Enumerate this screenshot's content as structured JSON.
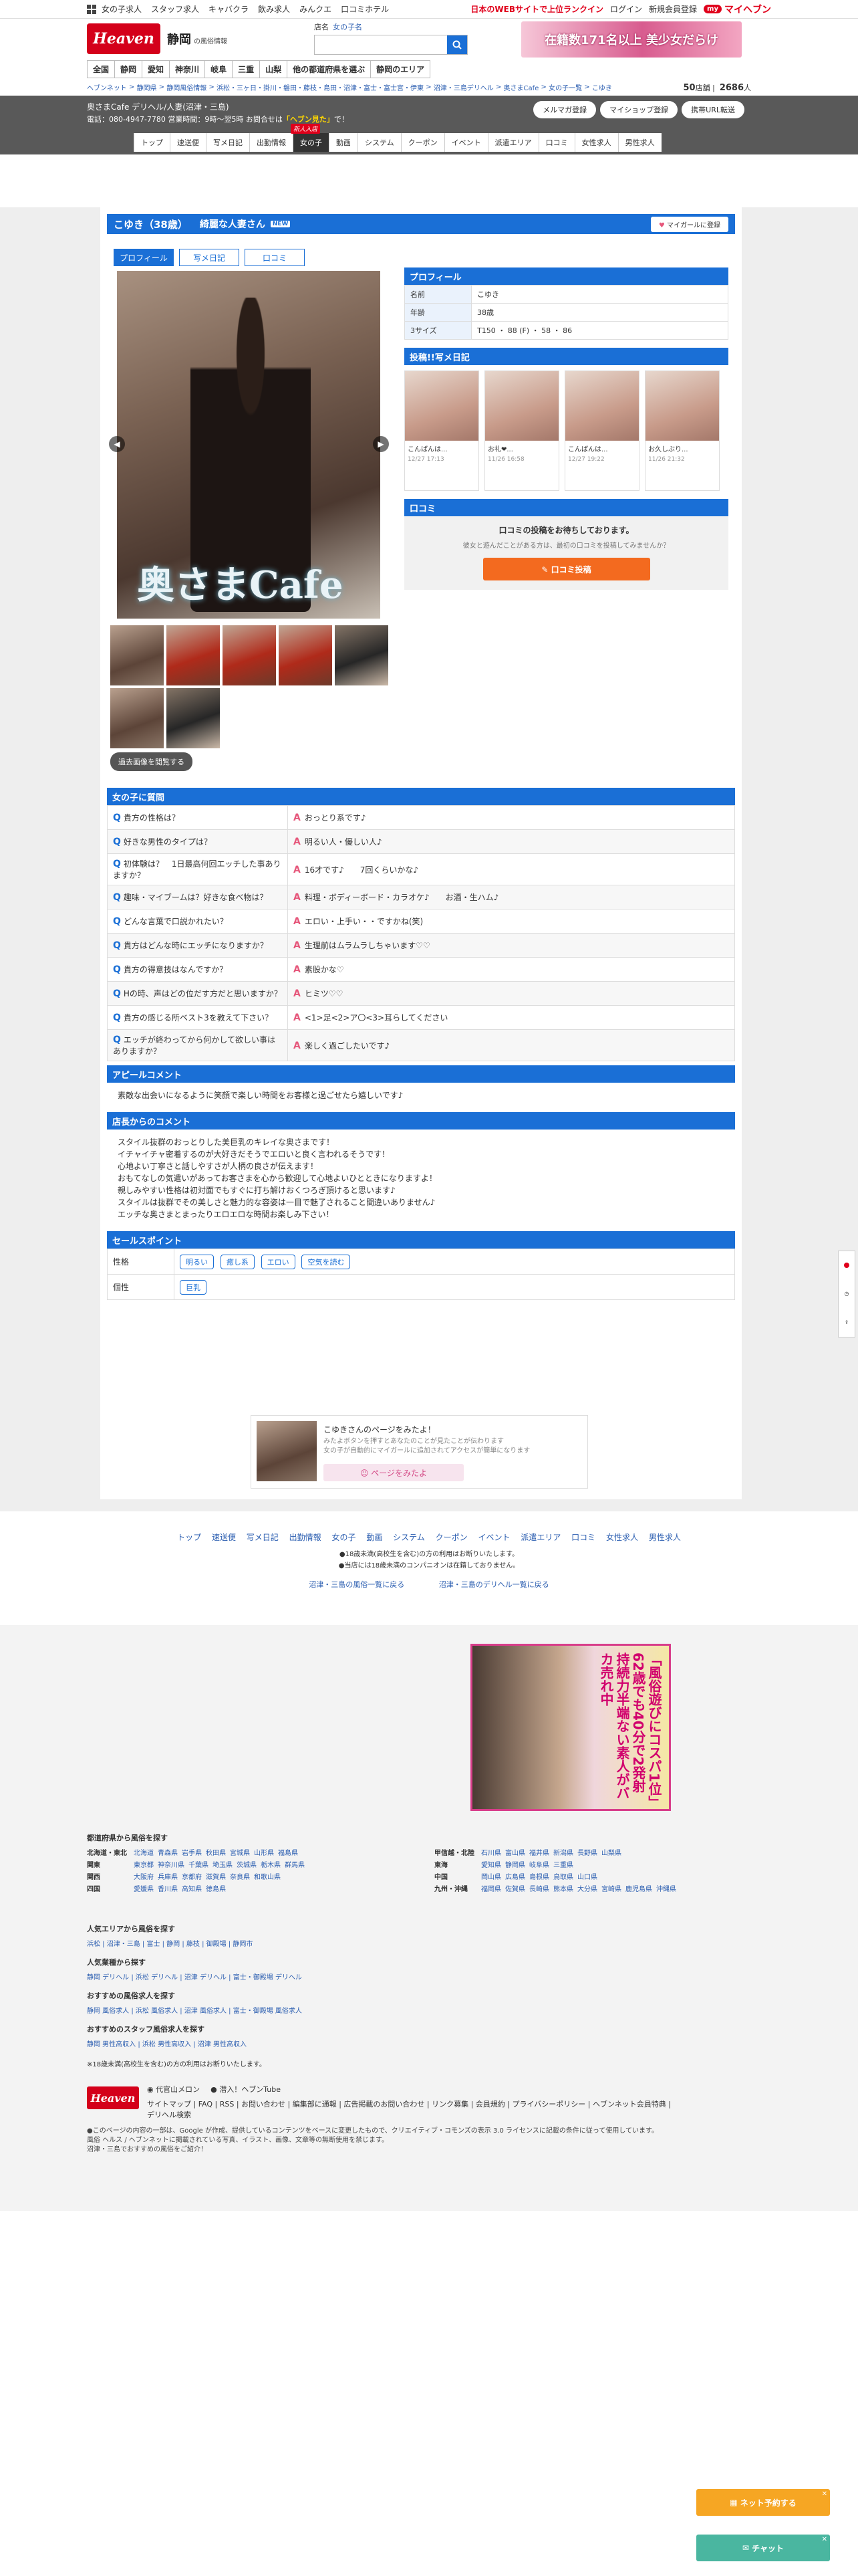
{
  "topbar": {
    "links": [
      "女の子求人",
      "スタッフ求人",
      "キャバクラ",
      "飲み求人",
      "みんクエ",
      "口コミホテル"
    ],
    "tagline": "日本のWEBサイトで上位ランクイン",
    "login": "ログイン",
    "register": "新規会員登録",
    "my_badge": "my",
    "my_label": "マイヘブン"
  },
  "header": {
    "logo": "Heaven",
    "region": "静岡",
    "region_sub": "の風俗情報",
    "search_label": "店名",
    "search_mode": "女の子名",
    "banner": "在籍数171名以上 美少女だらけ"
  },
  "prefnav": [
    "全国",
    "静岡",
    "愛知",
    "神奈川",
    "岐阜",
    "三重",
    "山梨",
    "他の都道府県を選ぶ",
    "静岡のエリア"
  ],
  "breadcrumb": {
    "items": [
      "ヘブンネット",
      "静岡県",
      "静岡風俗情報",
      "浜松・三ヶ日・掛川・磐田・藤枝・島田・沼津・富士・富士宮・伊東",
      "沼津・三島デリヘル",
      "奥さまCafe",
      "女の子一覧",
      "こゆき"
    ],
    "count_num": "50",
    "count_unit": "店舗",
    "count2_num": "2686",
    "count2_unit": "人"
  },
  "shop": {
    "name": "奥さまCafe デリヘル/人妻(沼津・三島)",
    "tel": "電話：080-4947-7780 営業時間：9時〜翌5時 お問合せは",
    "tel_highlight": "「ヘブン見た」",
    "tel_tail": "で！",
    "buttons": [
      "メルマガ登録",
      "マイショップ登録",
      "携帯URL転送"
    ],
    "nav": [
      "トップ",
      "速送便",
      "写メ日記",
      "出勤情報",
      "女の子",
      "動画",
      "システム",
      "クーポン",
      "イベント",
      "派遣エリア",
      "口コミ",
      "女性求人",
      "男性求人"
    ],
    "nav_new_badge": "新人入店"
  },
  "profile": {
    "name": "こゆき（38歳）",
    "subtitle": "綺麗な人妻さん",
    "new_tag": "NEW",
    "fav_heart": "♥",
    "fav_button": "マイガールに登録",
    "tabs": [
      "プロフィール",
      "写メ日記",
      "口コミ"
    ],
    "image_watermark": "奥さまCafe",
    "old_photo_button": "過去画像を閲覧する",
    "section_profile": "プロフィール",
    "fields": [
      {
        "k": "名前",
        "v": "こゆき"
      },
      {
        "k": "年齢",
        "v": "38歳"
      },
      {
        "k": "3サイズ",
        "v": "T150 ・ 88 (F) ・ 58 ・ 86"
      }
    ],
    "section_diary": "投稿!!写メ日記",
    "diary": [
      {
        "title": "こんばんは...",
        "date": "12/27 17:13"
      },
      {
        "title": "お礼❤︎...",
        "date": "11/26 16:58"
      },
      {
        "title": "こんばんは...",
        "date": "12/27 19:22"
      },
      {
        "title": "お久しぶり...",
        "date": "11/26 21:32"
      }
    ],
    "section_kuchi": "口コミ",
    "kuchi_msg": "口コミの投稿をお待ちしております。",
    "kuchi_sub": "彼女と遊んだことがある方は、最初の口コミを投稿してみませんか？",
    "kuchi_button": "✎ 口コミ投稿"
  },
  "qa": {
    "title": "女の子に質問",
    "q_mark": "Q",
    "a_mark": "A",
    "rows": [
      {
        "q": "貴方の性格は？",
        "a": "おっとり系です♪"
      },
      {
        "q": "好きな男性のタイプは？",
        "a": "明るい人・優しい人♪"
      },
      {
        "q": "初体験は？　1日最高何回エッチした事ありますか？",
        "a": "16才です♪　　7回くらいかな♪"
      },
      {
        "q": "趣味・マイブームは？好きな食べ物は？",
        "a": "料理・ボディーボード・カラオケ♪　　お酒・生ハム♪"
      },
      {
        "q": "どんな言葉で口説かれたい？",
        "a": "エロい・上手い・・ですかね(笑)"
      },
      {
        "q": "貴方はどんな時にエッチになりますか？",
        "a": "生理前はムラムラしちゃいます♡♡"
      },
      {
        "q": "貴方の得意技はなんですか？",
        "a": "素股かな♡"
      },
      {
        "q": "Hの時、声はどの位だす方だと思いますか？",
        "a": "ヒミツ♡♡"
      },
      {
        "q": "貴方の感じる所ベスト3を教えて下さい？",
        "a": "<1>足<2>ア〇<3>耳らしてください"
      },
      {
        "q": "エッチが終わってから何かして欲しい事はありますか？",
        "a": "楽しく過ごしたいです♪"
      }
    ]
  },
  "appeal": {
    "title": "アピールコメント",
    "body": "素敵な出会いになるように笑顔で楽しい時間をお客様と過ごせたら嬉しいです♪"
  },
  "shop_comment": {
    "title": "店長からのコメント",
    "lines": [
      "スタイル抜群のおっとりした美巨乳のキレイな奥さまです！",
      "イチャイチャ密着するのが大好きだそうでエロいと良く言われるそうです！",
      "心地よい丁寧さと話しやすさが人柄の良さが伝えます！",
      "おもてなしの気遣いがあってお客さまを心から歓迎して心地よいひとときになりますよ！",
      "親しみやすい性格は初対面でもすぐに打ち解けおくつろぎ頂けると思います♪",
      "スタイルは抜群でその美しさと魅力的な容姿は一目で魅了されること間違いありません♪",
      "エッチな奥さまとまったりエロエロな時間お楽しみ下さい！"
    ]
  },
  "sales": {
    "title": "セールスポイント",
    "rows": [
      {
        "k": "性格",
        "chips": [
          "明るい",
          "癒し系",
          "エロい",
          "空気を読む"
        ]
      },
      {
        "k": "個性",
        "chips": [
          "巨乳"
        ]
      }
    ]
  },
  "promo": {
    "title": "こゆきさんのページをみたよ！",
    "desc1": "みたよボタンを押すとあなたのことが見たことが伝わります",
    "desc2": "女の子が自動的にマイガールに追加されてアクセスが簡単になります",
    "button": "☺ ページをみたよ"
  },
  "bottomnav": {
    "links": [
      "トップ",
      "速送便",
      "写メ日記",
      "出勤情報",
      "女の子",
      "動画",
      "システム",
      "クーポン",
      "イベント",
      "派遣エリア",
      "口コミ",
      "女性求人",
      "男性求人"
    ],
    "note1": "●18歳未満(高校生を含む)の方の利用はお断りいたします。",
    "note2": "●当店には18歳未満のコンパニオンは在籍しておりません。",
    "back1": "沼津・三島の風俗一覧に戻る",
    "back2": "沼津・三島のデリヘル一覧に戻る"
  },
  "footer": {
    "ad_text": "「風俗遊びにコスパ1位」62歳でも40分で2発射 持続力半端ない素人がバカ売れ中",
    "sec1_title": "都道府県から風俗を探す",
    "regions_left": [
      {
        "k": "北海道・東北",
        "v": [
          "北海道",
          "青森県",
          "岩手県",
          "秋田県",
          "宮城県",
          "山形県",
          "福島県"
        ]
      },
      {
        "k": "関東",
        "v": [
          "東京都",
          "神奈川県",
          "千葉県",
          "埼玉県",
          "茨城県",
          "栃木県",
          "群馬県"
        ]
      },
      {
        "k": "関西",
        "v": [
          "大阪府",
          "兵庫県",
          "京都府",
          "滋賀県",
          "奈良県",
          "和歌山県"
        ]
      },
      {
        "k": "四国",
        "v": [
          "愛媛県",
          "香川県",
          "高知県",
          "徳島県"
        ]
      }
    ],
    "regions_right": [
      {
        "k": "甲信越・北陸",
        "v": [
          "石川県",
          "富山県",
          "福井県",
          "新潟県",
          "長野県",
          "山梨県"
        ]
      },
      {
        "k": "東海",
        "v": [
          "愛知県",
          "静岡県",
          "岐阜県",
          "三重県"
        ]
      },
      {
        "k": "中国",
        "v": [
          "岡山県",
          "広島県",
          "島根県",
          "鳥取県",
          "山口県"
        ]
      },
      {
        "k": "九州・沖縄",
        "v": [
          "福岡県",
          "佐賀県",
          "長崎県",
          "熊本県",
          "大分県",
          "宮崎県",
          "鹿児島県",
          "沖縄県"
        ]
      }
    ],
    "sec2_title": "人気エリアから風俗を探す",
    "sec2_links": "浜松 | 沼津・三島 | 富士 | 静岡 | 藤枝 | 御殿場 | 静岡市",
    "sec3_title": "人気業種から探す",
    "sec3_links": "静岡 デリヘル | 浜松 デリヘル | 沼津 デリヘル | 富士・御殿場 デリヘル",
    "sec4_title": "おすすめの風俗求人を探す",
    "sec4_links": "静岡 風俗求人 | 浜松 風俗求人 | 沼津 風俗求人 | 富士・御殿場 風俗求人",
    "sec5_title": "おすすめのスタッフ風俗求人を探す",
    "sec5_links": "静岡 男性高収入 | 浜松 男性高収入 | 沼津 男性高収入",
    "note": "※18歳未満(高校生を含む)の方の利用はお断りいたします。",
    "logo": "Heaven",
    "menu_a": "代官山メロン",
    "menu_b": "潜入！ヘブンTube",
    "sitemap": "サイトマップ",
    "sitemap2": "デリヘル検索",
    "menu_links": "| FAQ | RSS | お問い合わせ | 編集部に通報 | 広告掲載のお問い合わせ | リンク募集 | 会員規約 | プライバシーポリシー | ヘブンネット会員特典 |",
    "copy1": "●このページの内容の一部は、Google が作成、提供しているコンテンツをベースに変更したもので、クリエイティブ・コモンズの表示 3.0 ライセンスに記載の条件に従って使用しています。",
    "copy2": "風俗 ヘルス / ヘブンネットに掲載されている写真、イラスト、画像、文章等の無断使用を禁じます。",
    "copy3": "沼津・三島でおすすめの風俗をご紹介！"
  },
  "floating": {
    "net_reserve": "ネット予約する",
    "chat": "チャット",
    "close": "✕"
  }
}
